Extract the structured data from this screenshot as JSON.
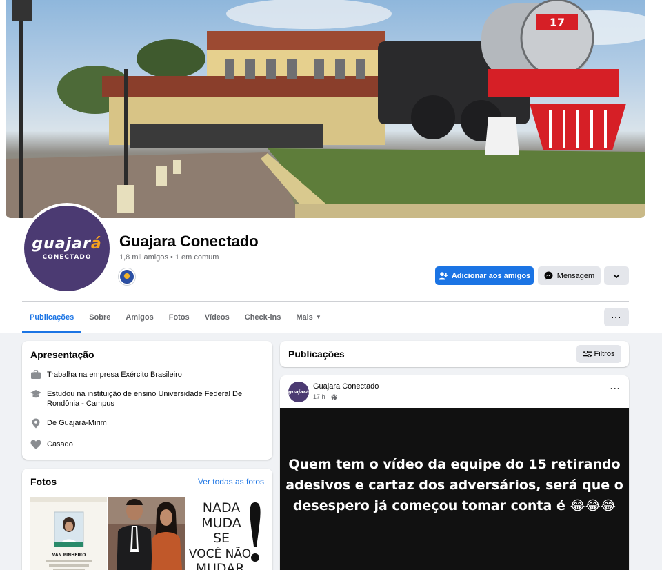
{
  "profile": {
    "name": "Guajara Conectado",
    "friends_line": "1,8 mil amigos • 1 em comum",
    "avatar_logo_main": "guajará",
    "avatar_logo_sub": "CONECTADO"
  },
  "actions": {
    "add_friend": "Adicionar aos amigos",
    "message": "Mensagem",
    "more_icon": "chevron-down-icon"
  },
  "tabs": [
    {
      "label": "Publicações",
      "active": true
    },
    {
      "label": "Sobre"
    },
    {
      "label": "Amigos"
    },
    {
      "label": "Fotos"
    },
    {
      "label": "Vídeos"
    },
    {
      "label": "Check-ins"
    },
    {
      "label": "Mais"
    }
  ],
  "cover_sign": "17",
  "intro": {
    "title": "Apresentação",
    "items": [
      {
        "icon": "briefcase-icon",
        "text": "Trabalha na empresa Exército Brasileiro"
      },
      {
        "icon": "graduation-cap-icon",
        "text": "Estudou na instituição de ensino Universidade Federal De Rondônia - Campus"
      },
      {
        "icon": "location-pin-icon",
        "text": "De Guajará-Mirim"
      },
      {
        "icon": "heart-icon",
        "text": "Casado"
      }
    ]
  },
  "photos": {
    "title": "Fotos",
    "see_all": "Ver todas as fotos",
    "photo1_name": "VAN PINHEIRO",
    "photo3_lines": [
      "NADA",
      "MUDA",
      "SE",
      "VOCÊ NÃO",
      "MUDAR"
    ]
  },
  "posts": {
    "title": "Publicações",
    "filter_label": "Filtros",
    "post": {
      "author": "Guajara Conectado",
      "time": "17 h ·",
      "text": "Quem tem o vídeo da equipe do 15 retirando adesivos e cartaz dos adversários, será que o desespero já começou tomar conta é 😂😂😂"
    }
  },
  "colors": {
    "accent": "#1b74e4",
    "logo_bg": "#4b3a72",
    "logo_accent": "#f6a21e"
  }
}
